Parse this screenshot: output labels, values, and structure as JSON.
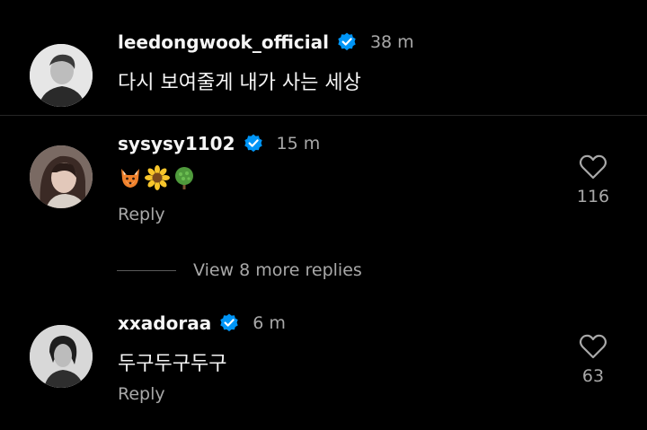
{
  "caption": {
    "username": "leedongwook_official",
    "time": "38 m",
    "text": "다시 보여줄게 내가 사는 세상"
  },
  "comments": [
    {
      "username": "sysysy1102",
      "time": "15 m",
      "emojis": [
        "fox-emoji",
        "sunflower-emoji",
        "tree-emoji"
      ],
      "reply_label": "Reply",
      "like_count": "116"
    },
    {
      "username": "xxadoraa",
      "time": "6 m",
      "text": "두구두구두구",
      "reply_label": "Reply",
      "like_count": "63"
    }
  ],
  "view_more_label": "View 8 more replies",
  "colors": {
    "background": "#000000",
    "primary_text": "#f5f5f5",
    "secondary_text": "#a8a8a8",
    "verified_badge": "#0095f6",
    "divider": "#262626"
  },
  "icons": {
    "verified": "verified-badge-icon",
    "like": "heart-outline-icon"
  }
}
